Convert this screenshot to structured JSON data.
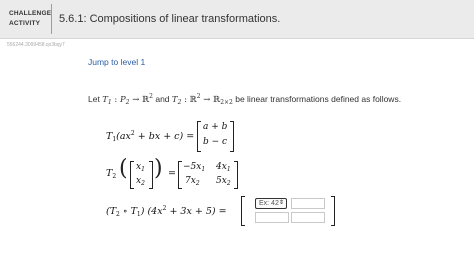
{
  "header": {
    "badge_line1": "CHALLENGE",
    "badge_line2": "ACTIVITY",
    "title": "5.6.1: Compositions of linear transformations."
  },
  "hash": "556244.3099458.qx3bqy7",
  "jump_label": "Jump to level 1",
  "intro": {
    "prefix": "Let",
    "T1": "T",
    "sub1": "1",
    "colon1": " : ",
    "P": "P",
    "P_sub": "2",
    "arrow": " → ",
    "R": "ℝ",
    "R_sup": "2",
    "and": " and ",
    "T2": "T",
    "sub2": "2",
    "colon2": " : ",
    "R2": "ℝ",
    "R2_sup": "2",
    "arrow2": " → ",
    "R3": "ℝ",
    "R3_sub": "2×2",
    "suffix": " be linear transformations defined as follows."
  },
  "eq1": {
    "lhs": "T",
    "lhs_sub": "1",
    "arg": "(ax",
    "arg_sup": "2",
    "arg_rest": " + bx + c) =",
    "m11": "a + b",
    "m21": "b − c"
  },
  "eq2": {
    "lhs": "T",
    "lhs_sub": "2",
    "x1": "x",
    "x1_sub": "1",
    "x2": "x",
    "x2_sub": "2",
    "eq": "=",
    "a11": "−5x",
    "a11_sub": "1",
    "a12": "4x",
    "a12_sub": "1",
    "a21": "7x",
    "a21_sub": "2",
    "a22": "5x",
    "a22_sub": "2"
  },
  "eq3": {
    "lhs": "(T",
    "s1": "2",
    "o": " ∘ T",
    "s2": "1",
    "rest": ") (4x",
    "sup": "2",
    "rest2": " + 3x + 5) ="
  },
  "answer": {
    "select_value": "Ex: 42",
    "select_arrow": "⇕"
  }
}
